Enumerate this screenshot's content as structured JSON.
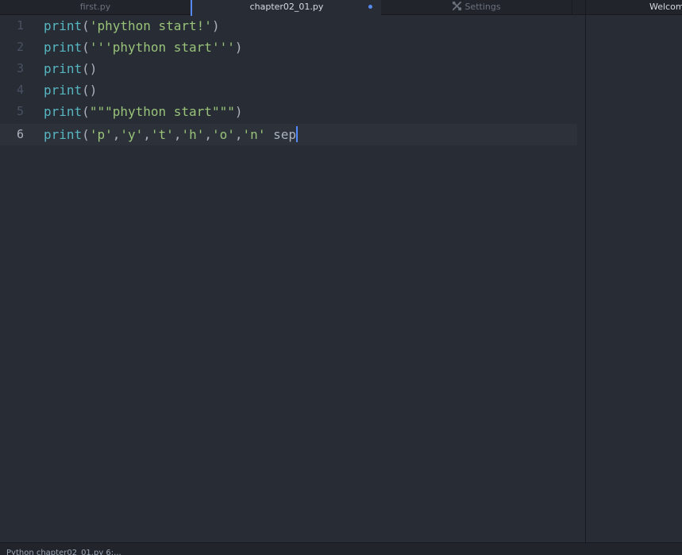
{
  "tabs": {
    "first": "first.py",
    "active": "chapter02_01.py",
    "settings": "Settings",
    "welcome": "Welcom"
  },
  "editor": {
    "lines": [
      {
        "num": "1",
        "fn": "print",
        "open": "(",
        "str": "'phython start!'",
        "close": ")"
      },
      {
        "num": "2",
        "fn": "print",
        "open": "(",
        "str": "'''phython start'''",
        "close": ")"
      },
      {
        "num": "3",
        "fn": "print",
        "open": "()",
        "str": "",
        "close": ""
      },
      {
        "num": "4",
        "fn": "print",
        "open": "()",
        "str": "",
        "close": ""
      },
      {
        "num": "5",
        "fn": "print",
        "open": "(",
        "str": "\"\"\"phython start\"\"\"",
        "close": ")"
      },
      {
        "num": "6",
        "fn": "print",
        "open": "(",
        "args": [
          "'p'",
          "'y'",
          "'t'",
          "'h'",
          "'o'",
          "'n'"
        ],
        "tail": " sep"
      }
    ]
  },
  "status": {
    "text": "Python chapter02_01.py  6:..."
  },
  "colors": {
    "accent": "#568af2",
    "background": "#282c34",
    "function": "#56b6c2",
    "string": "#98c379"
  },
  "icons": {
    "settings": "tools-icon"
  }
}
